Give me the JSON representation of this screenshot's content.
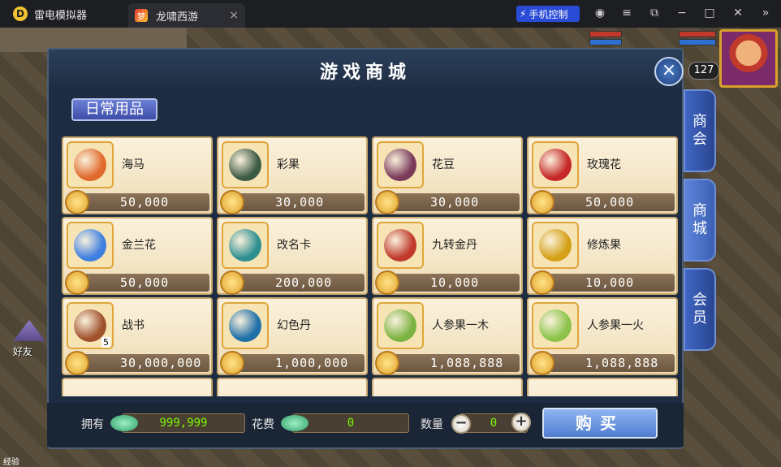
{
  "titlebar": {
    "app_logo": "D",
    "app_name": "雷电模拟器",
    "tab_label": "龙啸西游",
    "tab_icon": "game-icon",
    "phone_control": "手机控制",
    "close_x": "×",
    "window_buttons": [
      "account-icon",
      "menu-icon",
      "restore-icon",
      "minimize-icon",
      "maximize-icon",
      "close-icon",
      "expand-icon"
    ]
  },
  "hud": {
    "level": "127",
    "friend_label": "好友",
    "exp_label": "经验"
  },
  "shop": {
    "title": "游戏商城",
    "close": "×",
    "category": "日常用品",
    "items": [
      {
        "name": "海马",
        "price": "50,000",
        "color": "#e06a2c"
      },
      {
        "name": "彩果",
        "price": "30,000",
        "color": "#3d5a45"
      },
      {
        "name": "花豆",
        "price": "30,000",
        "color": "#7a3b5a"
      },
      {
        "name": "玫瑰花",
        "price": "50,000",
        "color": "#c62828"
      },
      {
        "name": "金兰花",
        "price": "50,000",
        "color": "#3f7fe0"
      },
      {
        "name": "改名卡",
        "price": "200,000",
        "color": "#2f8f8f"
      },
      {
        "name": "九转金丹",
        "price": "10,000",
        "color": "#c0392b"
      },
      {
        "name": "修炼果",
        "price": "10,000",
        "color": "#d4a017"
      },
      {
        "name": "战书",
        "price": "30,000,000",
        "color": "#a0522d",
        "badge": "5"
      },
      {
        "name": "幻色丹",
        "price": "1,000,000",
        "color": "#1f6fa8"
      },
      {
        "name": "人参果一木",
        "price": "1,088,888",
        "color": "#7cb342"
      },
      {
        "name": "人参果一火",
        "price": "1,088,888",
        "color": "#8bc34a"
      }
    ],
    "side_tabs": [
      {
        "label_top": "商",
        "label_bottom": "会"
      },
      {
        "label_top": "商",
        "label_bottom": "城"
      },
      {
        "label_top": "会",
        "label_bottom": "员"
      }
    ],
    "bottom": {
      "own_label": "拥有",
      "own_value": "999,999",
      "cost_label": "花费",
      "cost_value": "0",
      "qty_label": "数量",
      "qty_value": "0",
      "minus": "−",
      "plus": "+",
      "buy_label": "购买"
    }
  }
}
